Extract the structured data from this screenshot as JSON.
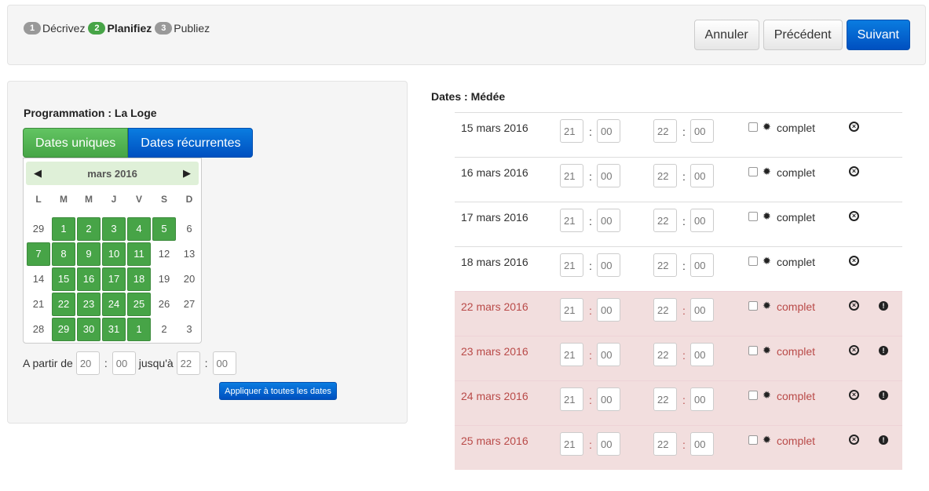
{
  "steps": [
    {
      "num": "1",
      "label": "Décrivez",
      "active": false
    },
    {
      "num": "2",
      "label": "Planifiez",
      "active": true
    },
    {
      "num": "3",
      "label": "Publiez",
      "active": false
    }
  ],
  "nav": {
    "cancel": "Annuler",
    "previous": "Précédent",
    "next": "Suivant"
  },
  "left": {
    "title_prefix": "Programmation : ",
    "title_value": "La Loge",
    "tab_unique": "Dates uniques",
    "tab_recurrent": "Dates récurrentes",
    "calendar": {
      "month": "mars 2016",
      "dow": [
        "L",
        "M",
        "M",
        "J",
        "V",
        "S",
        "D"
      ],
      "weeks": [
        [
          {
            "d": "29",
            "s": false
          },
          {
            "d": "1",
            "s": true
          },
          {
            "d": "2",
            "s": true
          },
          {
            "d": "3",
            "s": true
          },
          {
            "d": "4",
            "s": true
          },
          {
            "d": "5",
            "s": true
          },
          {
            "d": "6",
            "s": false
          }
        ],
        [
          {
            "d": "7",
            "s": true
          },
          {
            "d": "8",
            "s": true
          },
          {
            "d": "9",
            "s": true
          },
          {
            "d": "10",
            "s": true
          },
          {
            "d": "11",
            "s": true
          },
          {
            "d": "12",
            "s": false
          },
          {
            "d": "13",
            "s": false
          }
        ],
        [
          {
            "d": "14",
            "s": false
          },
          {
            "d": "15",
            "s": true
          },
          {
            "d": "16",
            "s": true
          },
          {
            "d": "17",
            "s": true
          },
          {
            "d": "18",
            "s": true
          },
          {
            "d": "19",
            "s": false
          },
          {
            "d": "20",
            "s": false
          }
        ],
        [
          {
            "d": "21",
            "s": false
          },
          {
            "d": "22",
            "s": true
          },
          {
            "d": "23",
            "s": true
          },
          {
            "d": "24",
            "s": true
          },
          {
            "d": "25",
            "s": true
          },
          {
            "d": "26",
            "s": false
          },
          {
            "d": "27",
            "s": false
          }
        ],
        [
          {
            "d": "28",
            "s": false
          },
          {
            "d": "29",
            "s": true
          },
          {
            "d": "30",
            "s": true
          },
          {
            "d": "31",
            "s": true
          },
          {
            "d": "1",
            "s": true
          },
          {
            "d": "2",
            "s": false
          },
          {
            "d": "3",
            "s": false
          }
        ]
      ]
    },
    "range": {
      "from_label": "A partir de",
      "from_h": "20",
      "from_m": "00",
      "to_label": "jusqu'à",
      "to_h": "22",
      "to_m": "00"
    },
    "apply_all": "Appliquer à toutes les dates"
  },
  "right": {
    "title": "Dates : Médée",
    "complet_label": "complet",
    "rows": [
      {
        "date": "15 mars 2016",
        "sh": "21",
        "sm": "00",
        "eh": "22",
        "em": "00",
        "error": false
      },
      {
        "date": "16 mars 2016",
        "sh": "21",
        "sm": "00",
        "eh": "22",
        "em": "00",
        "error": false
      },
      {
        "date": "17 mars 2016",
        "sh": "21",
        "sm": "00",
        "eh": "22",
        "em": "00",
        "error": false
      },
      {
        "date": "18 mars 2016",
        "sh": "21",
        "sm": "00",
        "eh": "22",
        "em": "00",
        "error": false
      },
      {
        "date": "22 mars 2016",
        "sh": "21",
        "sm": "00",
        "eh": "22",
        "em": "00",
        "error": true
      },
      {
        "date": "23 mars 2016",
        "sh": "21",
        "sm": "00",
        "eh": "22",
        "em": "00",
        "error": true
      },
      {
        "date": "24 mars 2016",
        "sh": "21",
        "sm": "00",
        "eh": "22",
        "em": "00",
        "error": true
      },
      {
        "date": "25 mars 2016",
        "sh": "21",
        "sm": "00",
        "eh": "22",
        "em": "00",
        "error": true
      }
    ]
  },
  "colors": {
    "green": "#47a447",
    "blue": "#0050c0",
    "error_bg": "#f2dede",
    "error_text": "#b94a48"
  },
  "icons": {
    "prev": "skip-back-icon",
    "next": "skip-forward-icon",
    "remove": "remove-circle-icon",
    "warning": "exclamation-icon",
    "star": "certificate-icon"
  }
}
